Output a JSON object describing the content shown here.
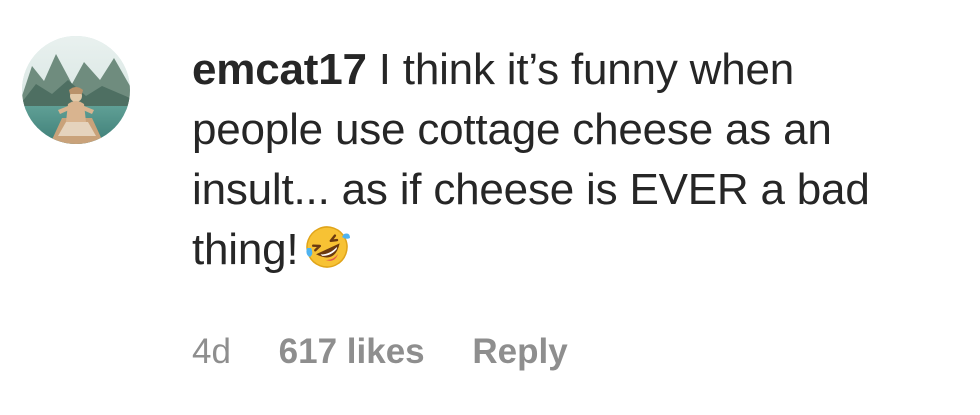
{
  "comment": {
    "username": "emcat17",
    "text_lines": [
      " I think it’s funny when",
      "people use cottage cheese as an",
      "insult... as if cheese is EVER a bad",
      "thing!"
    ],
    "emoji": "rolling-on-the-floor-laughing-emoji",
    "avatar": "profile-avatar-lake-photo"
  },
  "meta": {
    "age": "4d",
    "likes": "617 likes",
    "reply_label": "Reply"
  },
  "colors": {
    "text": "#262626",
    "secondary": "#8e8e8e"
  }
}
